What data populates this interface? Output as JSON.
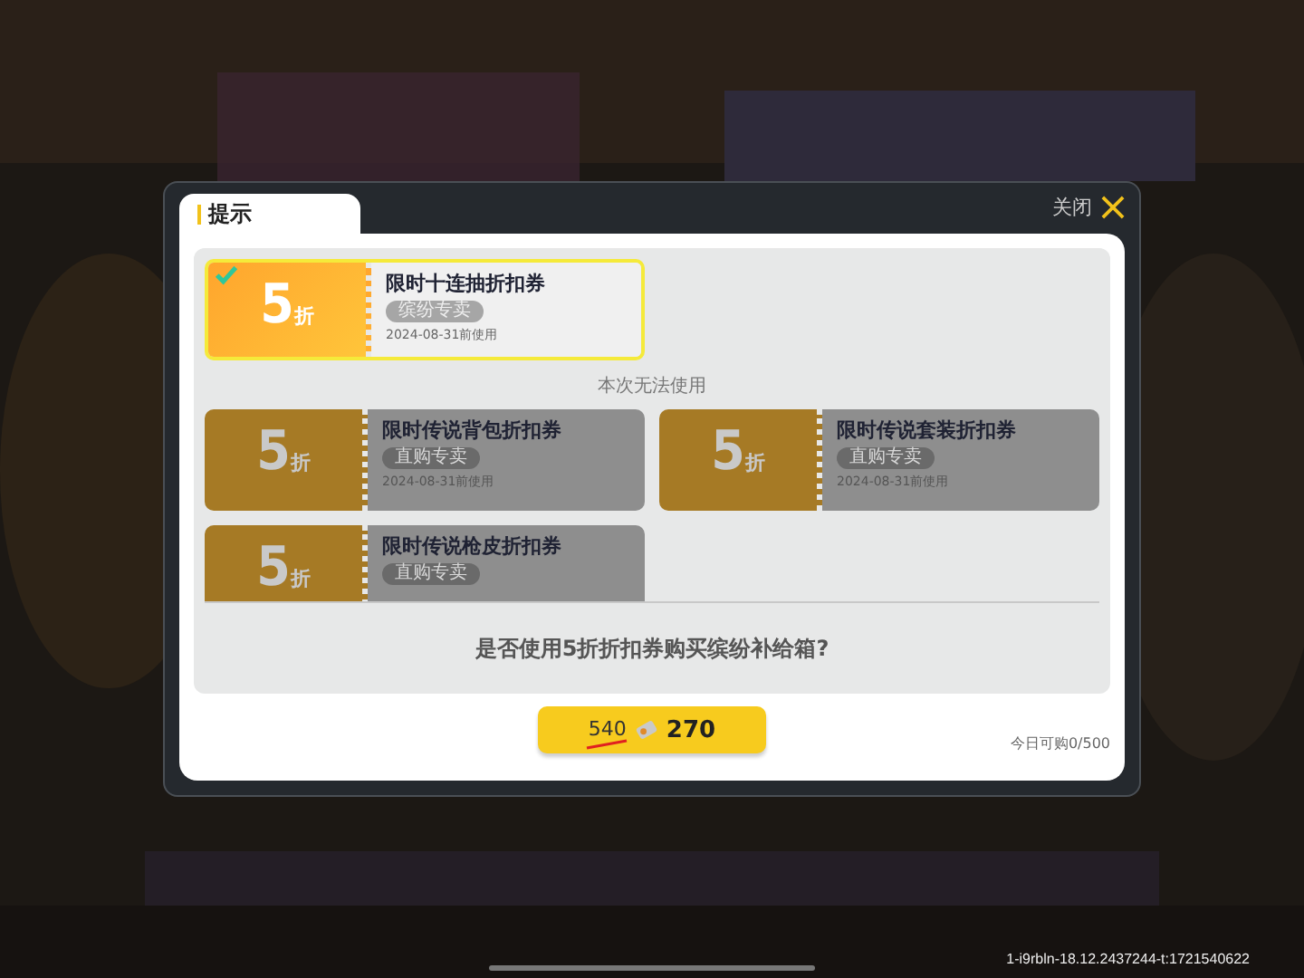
{
  "dialog": {
    "tab": "提示",
    "close_label": "关闭"
  },
  "coupons": [
    {
      "discount": "5",
      "unit": "折",
      "title": "限时十连抽折扣券",
      "tag": "缤纷专卖",
      "date": "2024-08-31前使用",
      "selected": true,
      "usable": true
    }
  ],
  "unusable_heading": "本次无法使用",
  "unusable_coupons": [
    {
      "discount": "5",
      "unit": "折",
      "title": "限时传说背包折扣券",
      "tag": "直购专卖",
      "date": "2024-08-31前使用"
    },
    {
      "discount": "5",
      "unit": "折",
      "title": "限时传说套装折扣券",
      "tag": "直购专卖",
      "date": "2024-08-31前使用"
    },
    {
      "discount": "5",
      "unit": "折",
      "title": "限时传说枪皮折扣券",
      "tag": "直购专卖"
    }
  ],
  "question": "是否使用5折折扣券购买缤纷补给箱?",
  "buy_button": {
    "old_price": "540",
    "price": "270"
  },
  "daily_limit": "今日可购0/500",
  "build_info": "1-i9rbln-18.12.2437244-t:1721540622"
}
